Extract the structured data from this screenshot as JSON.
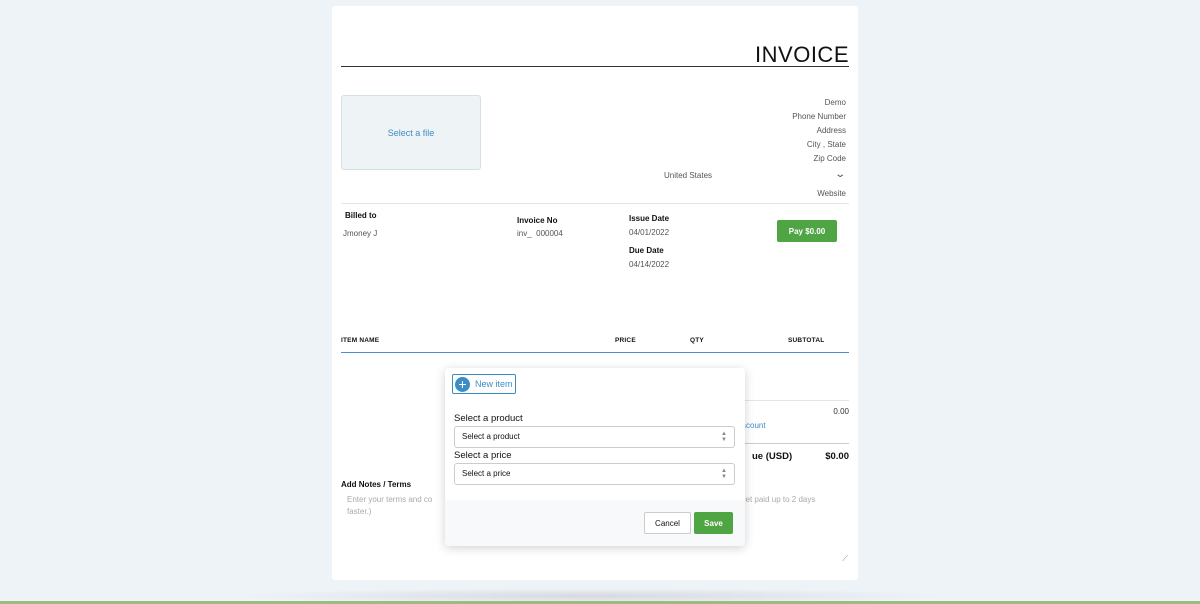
{
  "invoice": {
    "title": "INVOICE",
    "logo_upload_label": "Select a file",
    "company": {
      "name": "Demo",
      "phone": "Phone Number",
      "address": "Address",
      "city_state": "City ,  State",
      "zip": "Zip Code",
      "country": "United States",
      "website": "Website"
    },
    "billed_to_label": "Billed to",
    "billed_to_value": "Jmoney J",
    "invoice_no_label": "Invoice No",
    "invoice_no_value": "inv_  000004",
    "issue_date_label": "Issue Date",
    "issue_date_value": "04/01/2022",
    "due_date_label": "Due Date",
    "due_date_value": "04/14/2022",
    "pay_button": "Pay $0.00",
    "table_headers": {
      "item": "ITEM NAME",
      "price": "PRICE",
      "qty": "QTY",
      "subtotal": "SUBTOTAL"
    },
    "subtotal_value": "0.00",
    "discount_link_partial": "scount",
    "total_label_partial": "ue (USD)",
    "total_value": "$0.00",
    "notes_label": "Add Notes / Terms",
    "notes_placeholder_start": "Enter your terms and co",
    "notes_placeholder_line2": "faster.)",
    "notes_placeholder_tail": "\" get paid up to 2 days"
  },
  "modal": {
    "new_item_label": "New item",
    "product_label": "Select a product",
    "product_select_value": "Select a product",
    "price_label": "Select a price",
    "price_select_value": "Select a price",
    "cancel_button": "Cancel",
    "save_button": "Save"
  },
  "colors": {
    "accent": "#3d8dc5",
    "success": "#4fa443",
    "background": "#eef3f8"
  }
}
